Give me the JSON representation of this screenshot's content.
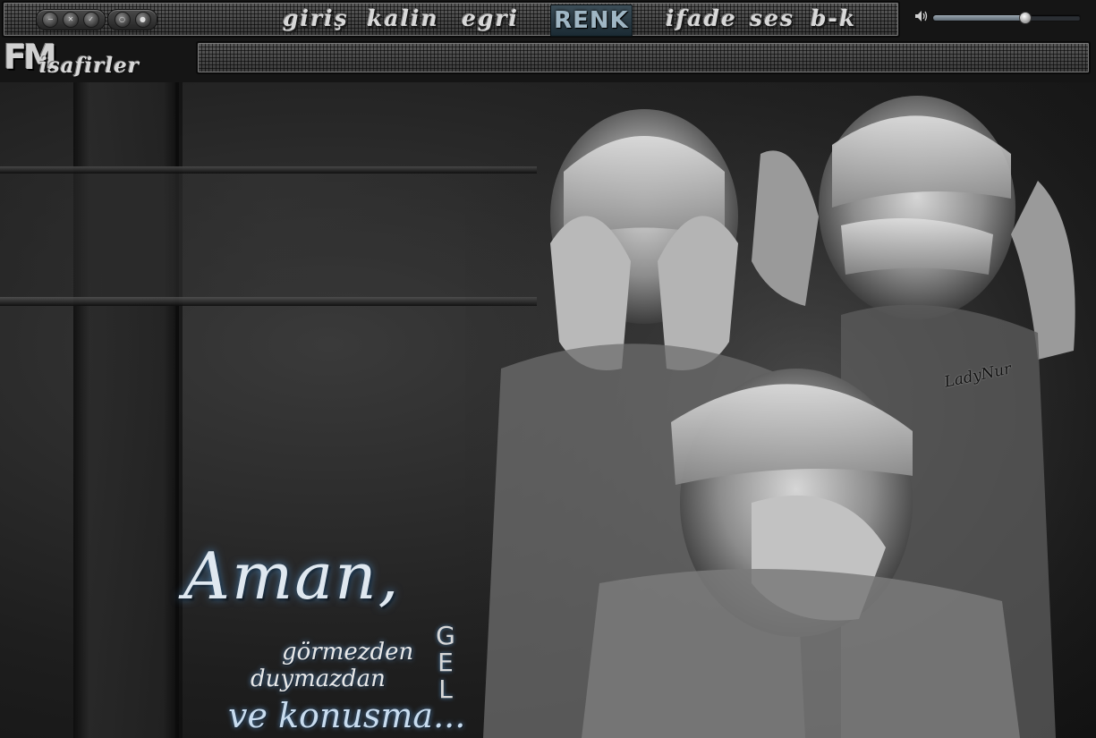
{
  "toolbar": {
    "menu": [
      {
        "label": "giriş"
      },
      {
        "label": "kalin"
      },
      {
        "label": "egri"
      },
      {
        "label": "RENK"
      },
      {
        "label": "ifade"
      },
      {
        "label": "ses"
      },
      {
        "label": "b-k"
      }
    ],
    "window_buttons": [
      "minimize-icon",
      "close-icon",
      "check-icon"
    ],
    "media_buttons": [
      "circle-icon",
      "record-icon"
    ]
  },
  "volume": {
    "level": 0.62,
    "icon": "speaker-icon"
  },
  "logo": {
    "badge": "FM",
    "text": "isafirler"
  },
  "ticker": {
    "text": ""
  },
  "artwork": {
    "signature": "LadyNur",
    "quote": {
      "main": "Aman,",
      "line1": "görmezden",
      "line2": "duymazdan",
      "line3": "ve konusma...",
      "vertical": [
        "G",
        "E",
        "L"
      ]
    }
  },
  "colors": {
    "accent": "#3d4e58",
    "glow": "#4a7fb0",
    "background": "#151515"
  }
}
